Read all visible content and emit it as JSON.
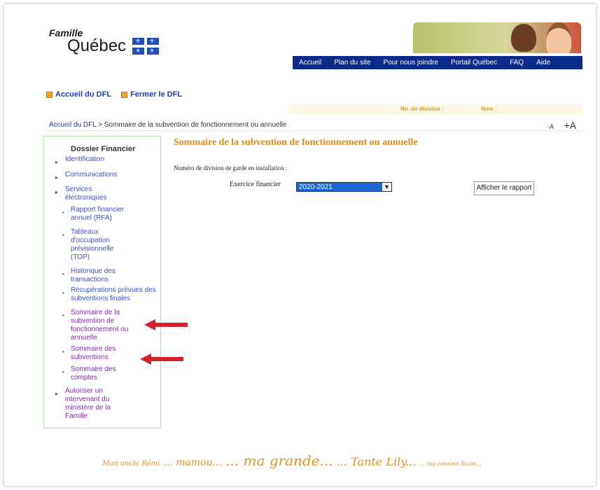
{
  "header": {
    "logo_top": "Famille",
    "logo_main": "Québec"
  },
  "topnav": [
    "Accueil",
    "Plan du site",
    "Pour nous joindre",
    "Portail Québec",
    "FAQ",
    "Aide"
  ],
  "quick_links": [
    "Accueil du DFL",
    "Fermer le DFL"
  ],
  "division_bar": {
    "division_label": "No. de division :",
    "name_label": "Nom :"
  },
  "breadcrumb": {
    "home": "Accueil du DFL",
    "separator": ">",
    "current": "Sommaire de la subvention de fonctionnement ou annuelle"
  },
  "font_controls": {
    "smaller": "-A",
    "larger": "+A"
  },
  "sidebar": {
    "title": "Dossier Financier",
    "items": [
      {
        "label": "Identification"
      },
      {
        "label": "Communications"
      },
      {
        "label": "Services électroniques"
      },
      {
        "label": "Rapport financier annuel (RFA)"
      },
      {
        "label": "Tableaux d'occupation prévisionnelle (TOP)"
      },
      {
        "label": "Historique des transactions"
      },
      {
        "label": "Récupérations prévues des subventions finales"
      },
      {
        "label": "Sommaire de la subvention de fonctionnement ou annuelle"
      },
      {
        "label": "Sommaire des subventions"
      },
      {
        "label": "Sommaire des comptes"
      },
      {
        "label": "Autoriser un intervenant du ministère de la Famille"
      }
    ]
  },
  "main": {
    "title": "Sommaire de la subvention de fonctionnement ou annuelle",
    "division_label": "Numéro de division de garde en installation :",
    "exercice_label": "Exercice financier",
    "exercice_value": "2020-2021",
    "report_button": "Afficher le rapport"
  },
  "footer": {
    "parts": [
      "Mon oncle Rémi",
      "... mamou...",
      "... ma grande...",
      "... Tante Lily...",
      "... ma cousine Suzie..."
    ]
  },
  "colors": {
    "nav_bg": "#0c2a8a",
    "title_orange": "#d98b1a",
    "link_blue": "#1f3fa8",
    "arrow_red": "#d6202a",
    "select_blue": "#1a66d2"
  }
}
